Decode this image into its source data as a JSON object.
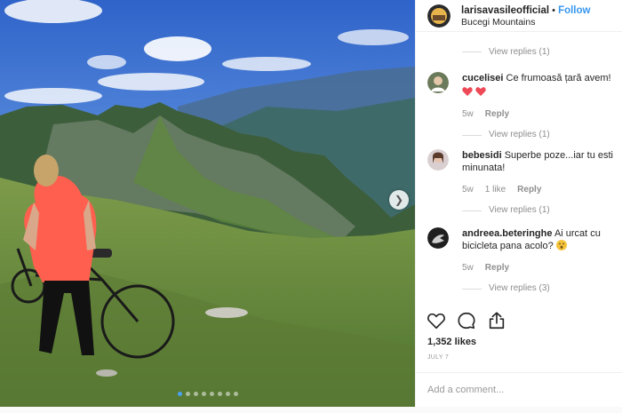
{
  "header": {
    "username": "larisavasileofficial",
    "separator": " • ",
    "follow_label": "Follow",
    "location": "Bucegi Mountains"
  },
  "top_view_replies": "View replies (1)",
  "comments": [
    {
      "user": "cucelisei",
      "text": "Ce frumoasă țară avem!",
      "emoji": "heart-emoji heart-emoji",
      "age": "5w",
      "likes": "",
      "reply": "Reply",
      "view_replies": "View replies (1)"
    },
    {
      "user": "bebesidi",
      "text": "Superbe poze...iar tu esti minunata!",
      "age": "5w",
      "likes": "1 like",
      "reply": "Reply",
      "view_replies": "View replies (1)"
    },
    {
      "user": "andreea.beteringhe",
      "text": "Ai urcat cu bicicleta pana acolo?",
      "emoji": "surprised-face-emoji",
      "age": "5w",
      "likes": "",
      "reply": "Reply",
      "view_replies": "View replies (3)"
    }
  ],
  "likes": "1,352 likes",
  "date": "JULY 7",
  "add_comment_placeholder": "Add a comment...",
  "carousel": {
    "total": 8,
    "active": 0
  },
  "colors": {
    "link": "#3897f0",
    "muted": "#8e8e8e",
    "heart": "#ed4956"
  },
  "icons": [
    "like-heart-icon",
    "comment-bubble-icon",
    "share-icon",
    "next-arrow-icon"
  ]
}
